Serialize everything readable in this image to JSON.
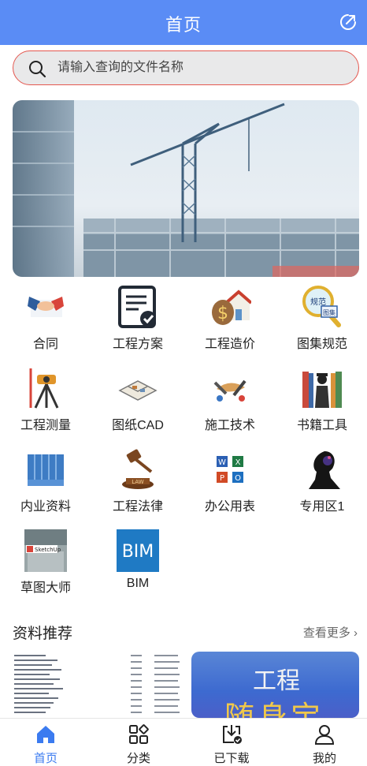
{
  "header": {
    "title": "首页",
    "action_icon": "share-icon"
  },
  "search": {
    "placeholder": "请输入查询的文件名称"
  },
  "banner": {
    "image": "construction-crane-banner"
  },
  "categories": [
    {
      "label": "合同",
      "icon": "handshake-icon"
    },
    {
      "label": "工程方案",
      "icon": "document-check-icon"
    },
    {
      "label": "工程造价",
      "icon": "money-house-icon"
    },
    {
      "label": "图集规范",
      "icon": "magnifier-atlas-icon"
    },
    {
      "label": "工程测量",
      "icon": "surveying-tripod-icon"
    },
    {
      "label": "图纸CAD",
      "icon": "floorplan-icon"
    },
    {
      "label": "施工技术",
      "icon": "tools-icon"
    },
    {
      "label": "书籍工具",
      "icon": "books-icon"
    },
    {
      "label": "内业资料",
      "icon": "binders-icon"
    },
    {
      "label": "工程法律",
      "icon": "gavel-icon"
    },
    {
      "label": "办公用表",
      "icon": "office-apps-icon"
    },
    {
      "label": "专用区1",
      "icon": "silhouette-icon"
    },
    {
      "label": "草图大师",
      "icon": "sketchup-icon"
    },
    {
      "label": "BIM",
      "icon": "bim-icon",
      "icon_text": "BIM"
    }
  ],
  "recommend": {
    "title": "资料推荐",
    "more": "查看更多 ›",
    "card_title": "工程",
    "card_sub": "随身宝"
  },
  "tabbar": [
    {
      "label": "首页",
      "icon": "home-icon",
      "active": true
    },
    {
      "label": "分类",
      "icon": "category-icon",
      "active": false
    },
    {
      "label": "已下载",
      "icon": "download-icon",
      "active": false
    },
    {
      "label": "我的",
      "icon": "profile-icon",
      "active": false
    }
  ],
  "colors": {
    "primary": "#5a8cf5",
    "active_tab": "#3b7bf0",
    "search_border": "#e4574f"
  }
}
